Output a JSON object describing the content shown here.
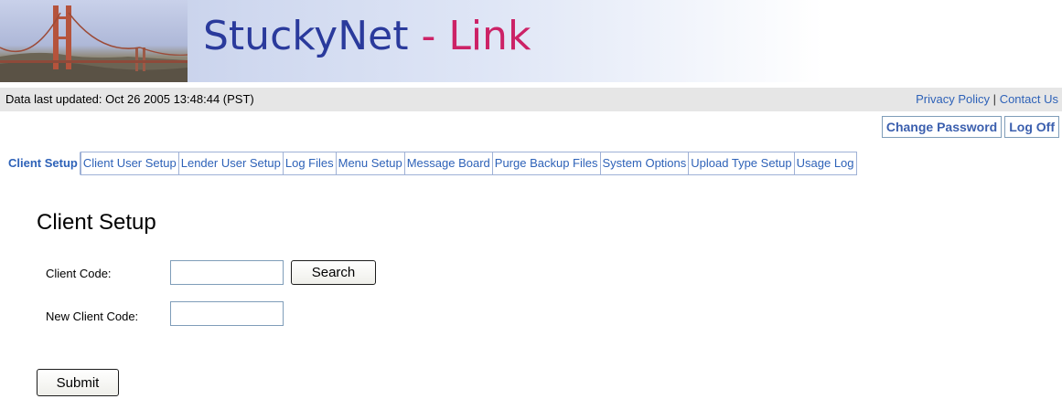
{
  "header": {
    "brand_part1": "StuckyNet",
    "brand_sep": " - ",
    "brand_part2": "Link",
    "brand_color1": "#2a3a9c",
    "brand_color2": "#cc2266"
  },
  "status": {
    "updated": "Data last updated:  Oct 26 2005 13:48:44 (PST)",
    "privacy_link": "Privacy Policy",
    "separator": "|",
    "contact_link": "Contact Us"
  },
  "account": {
    "change_password": "Change Password",
    "log_off": "Log Off"
  },
  "tabs": [
    {
      "label": "Client Setup",
      "active": true
    },
    {
      "label": "Client User Setup",
      "active": false
    },
    {
      "label": "Lender User Setup",
      "active": false
    },
    {
      "label": "Log Files",
      "active": false
    },
    {
      "label": "Menu Setup",
      "active": false
    },
    {
      "label": "Message Board",
      "active": false
    },
    {
      "label": "Purge Backup Files",
      "active": false
    },
    {
      "label": "System Options",
      "active": false
    },
    {
      "label": "Upload Type Setup",
      "active": false
    },
    {
      "label": "Usage Log",
      "active": false
    }
  ],
  "form": {
    "title": "Client Setup",
    "client_code_label": "Client Code:",
    "client_code_value": "",
    "search_button": "Search",
    "new_client_code_label": "New Client Code:",
    "new_client_code_value": "",
    "submit_button": "Submit"
  },
  "colors": {
    "link": "#2e62b8",
    "status_bar_bg": "#e6e6e6"
  }
}
